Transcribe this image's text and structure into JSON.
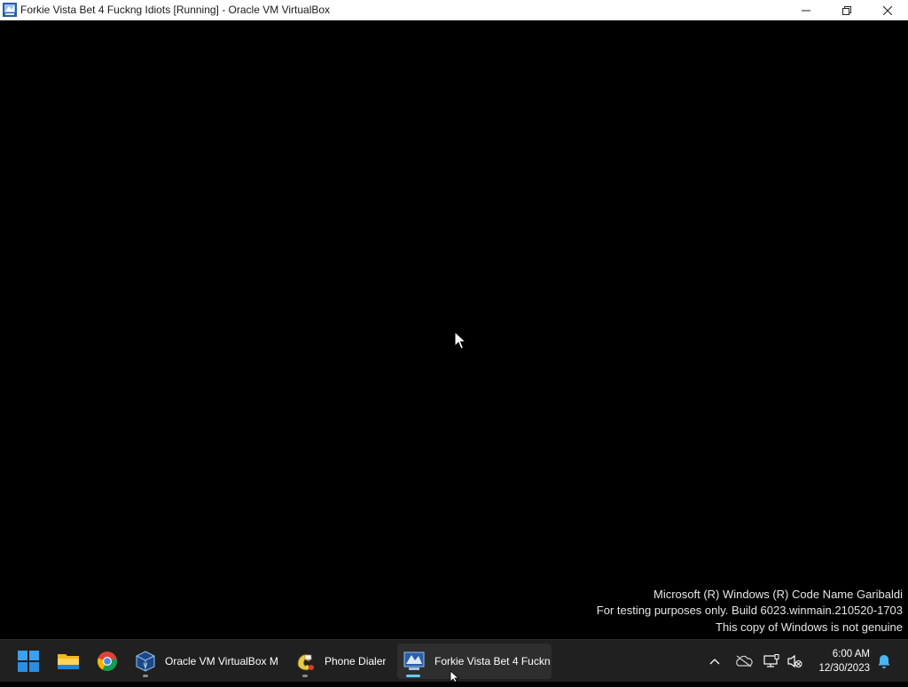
{
  "window": {
    "title": "Forkie Vista Bet 4 Fuckng Idiots [Running] - Oracle VM VirtualBox",
    "controls": [
      "minimize-icon",
      "restore-icon",
      "close-icon"
    ]
  },
  "vm_screen": {
    "watermark": {
      "line1": "Microsoft (R) Windows (R) Code Name Garibaldi",
      "line2": "For testing purposes only. Build 6023.winmain.210520-1703",
      "line3": "This copy of Windows is not genuine"
    }
  },
  "taskbar": {
    "pinned": [
      "windows-start-icon",
      "file-explorer-icon",
      "chrome-icon"
    ],
    "apps": [
      {
        "label": "Oracle VM VirtualBox M",
        "icon": "virtualbox-icon",
        "active": false
      },
      {
        "label": "Phone Dialer",
        "icon": "phone-dialer-icon",
        "active": false
      },
      {
        "label": "Forkie Vista Bet 4 Fuckn",
        "icon": "vista-vm-icon",
        "active": true
      }
    ],
    "tray": {
      "icons": [
        "chevron-up-icon",
        "onedrive-offline-icon",
        "network-icon",
        "volume-muted-icon",
        "notification-bell-icon"
      ],
      "time": "6:00 AM",
      "date": "12/30/2023",
      "accent": "#60cdff"
    }
  }
}
